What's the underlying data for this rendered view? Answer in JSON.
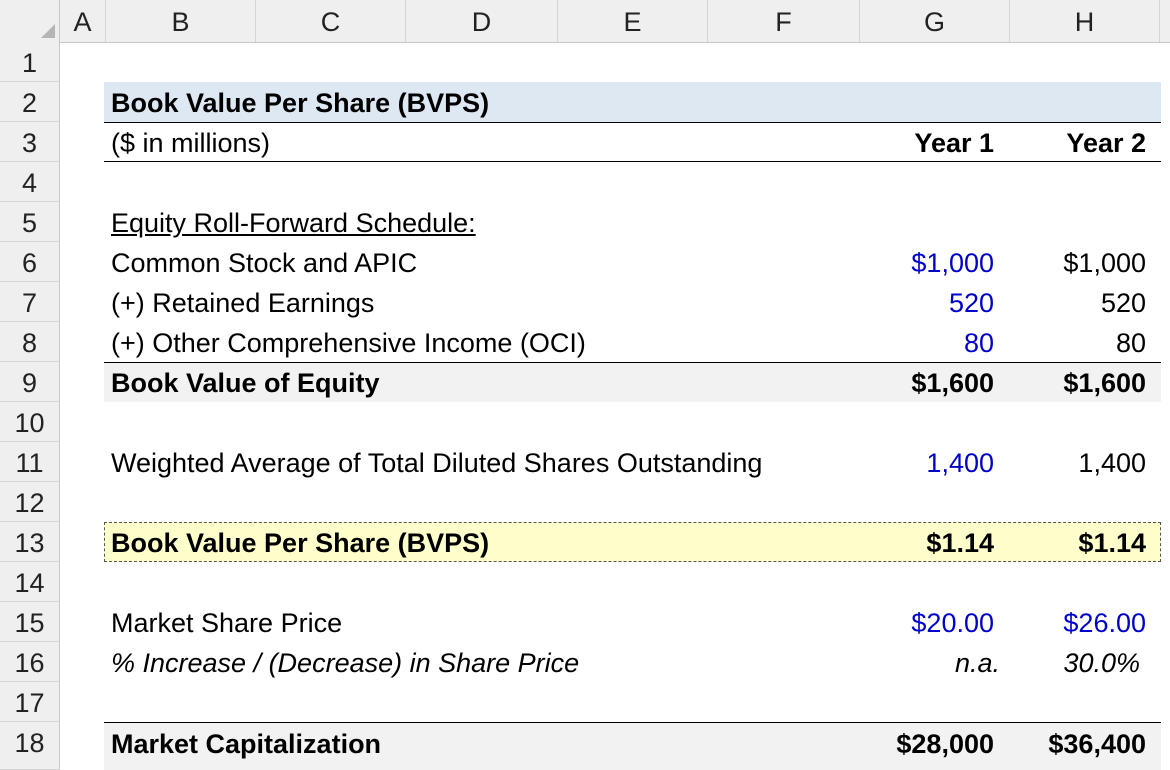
{
  "columns": [
    "A",
    "B",
    "C",
    "D",
    "E",
    "F",
    "G",
    "H"
  ],
  "rows": [
    "1",
    "2",
    "3",
    "4",
    "5",
    "6",
    "7",
    "8",
    "9",
    "10",
    "11",
    "12",
    "13",
    "14",
    "15",
    "16",
    "17",
    "18"
  ],
  "title": "Book Value Per Share (BVPS)",
  "units": "($ in millions)",
  "year1": "Year 1",
  "year2": "Year 2",
  "schedule_header": "Equity Roll-Forward Schedule:",
  "common_stock": {
    "label": "Common Stock and APIC",
    "y1": "$1,000",
    "y2": "$1,000"
  },
  "retained": {
    "label": "(+) Retained Earnings",
    "y1": "520",
    "y2": "520"
  },
  "oci": {
    "label": "(+) Other Comprehensive Income (OCI)",
    "y1": "80",
    "y2": "80"
  },
  "bv_equity": {
    "label": "Book Value of Equity",
    "y1": "$1,600",
    "y2": "$1,600"
  },
  "shares": {
    "label": "Weighted Average of Total Diluted Shares Outstanding",
    "y1": "1,400",
    "y2": "1,400"
  },
  "bvps": {
    "label": "Book Value Per Share (BVPS)",
    "y1": "$1.14",
    "y2": "$1.14"
  },
  "price": {
    "label": "Market Share Price",
    "y1": "$20.00",
    "y2": "$26.00"
  },
  "pct": {
    "label": "% Increase / (Decrease) in Share Price",
    "y1": "n.a.",
    "y2": "30.0%"
  },
  "mcap": {
    "label": "Market Capitalization",
    "y1": "$28,000",
    "y2": "$36,400"
  },
  "colors": {
    "title_band": "#dde8f3",
    "gray_band": "#f2f2f2",
    "highlight_band": "#ffffcc",
    "input_blue": "#0000cc"
  }
}
